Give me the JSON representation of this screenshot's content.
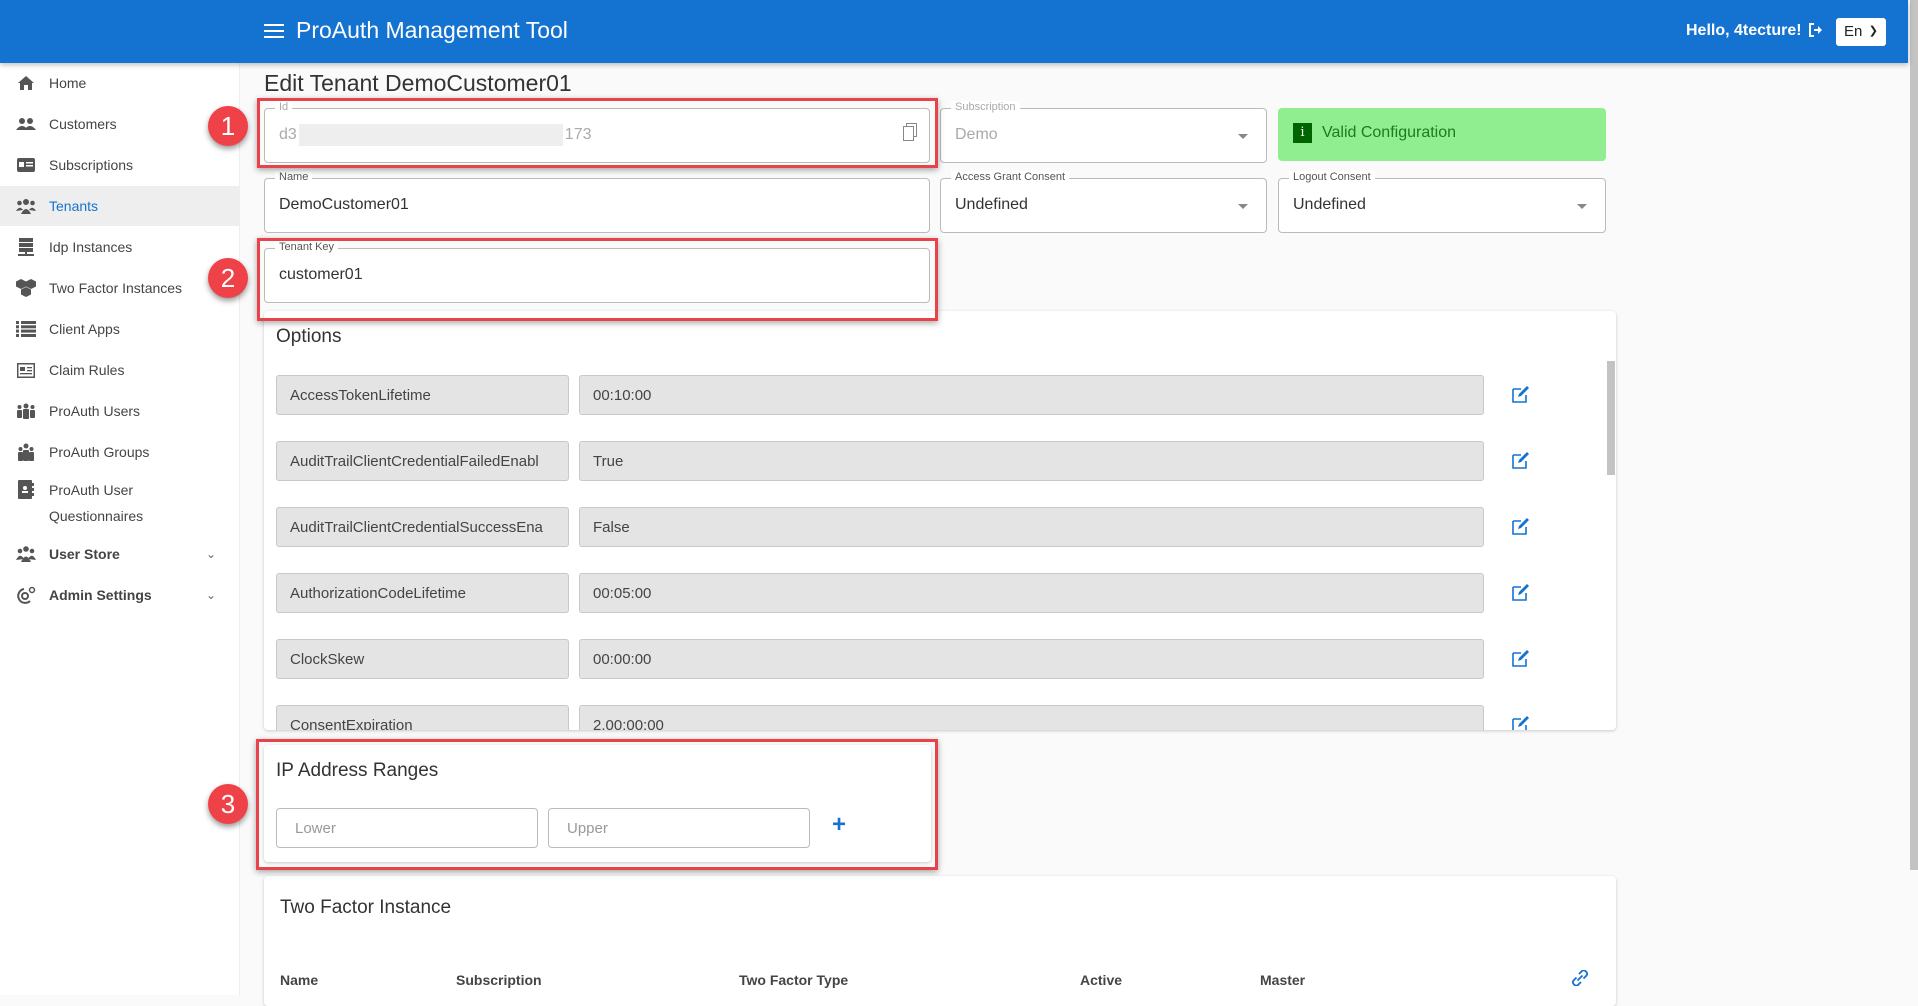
{
  "header": {
    "title": "ProAuth Management Tool",
    "greeting": "Hello, 4tecture!",
    "language": "En"
  },
  "sidebar": {
    "items": [
      {
        "label": "Home",
        "icon": "home-icon"
      },
      {
        "label": "Customers",
        "icon": "customers-icon"
      },
      {
        "label": "Subscriptions",
        "icon": "subscriptions-icon"
      },
      {
        "label": "Tenants",
        "icon": "tenants-icon",
        "active": true
      },
      {
        "label": "Idp Instances",
        "icon": "server-icon"
      },
      {
        "label": "Two Factor Instances",
        "icon": "cubes-icon"
      },
      {
        "label": "Client Apps",
        "icon": "list-icon"
      },
      {
        "label": "Claim Rules",
        "icon": "newspaper-icon"
      },
      {
        "label": "ProAuth Users",
        "icon": "users-icon"
      },
      {
        "label": "ProAuth Groups",
        "icon": "group-icon"
      },
      {
        "label": "ProAuth User Questionnaires",
        "label_line1": "ProAuth User",
        "label_line2": "Questionnaires",
        "icon": "address-book-icon"
      },
      {
        "label": "User Store",
        "icon": "user-store-icon",
        "expandable": true
      },
      {
        "label": "Admin Settings",
        "icon": "admin-settings-icon",
        "expandable": true
      }
    ]
  },
  "page": {
    "title": "Edit Tenant DemoCustomer01"
  },
  "form": {
    "id": {
      "label": "Id",
      "value_prefix": "d3",
      "value_suffix": "173"
    },
    "subscription": {
      "label": "Subscription",
      "value": "Demo"
    },
    "status": {
      "text": "Valid Configuration",
      "icon": "i"
    },
    "name": {
      "label": "Name",
      "value": "DemoCustomer01"
    },
    "access_grant_consent": {
      "label": "Access Grant Consent",
      "value": "Undefined"
    },
    "logout_consent": {
      "label": "Logout Consent",
      "value": "Undefined"
    },
    "tenant_key": {
      "label": "Tenant Key",
      "value": "customer01"
    }
  },
  "options": {
    "title": "Options",
    "rows": [
      {
        "key": "AccessTokenLifetime",
        "value": "00:10:00"
      },
      {
        "key": "AuditTrailClientCredentialFailedEnabl",
        "value": "True"
      },
      {
        "key": "AuditTrailClientCredentialSuccessEna",
        "value": "False"
      },
      {
        "key": "AuthorizationCodeLifetime",
        "value": "00:05:00"
      },
      {
        "key": "ClockSkew",
        "value": "00:00:00"
      },
      {
        "key": "ConsentExpiration",
        "value": "2.00:00:00"
      }
    ]
  },
  "ip_ranges": {
    "title": "IP Address Ranges",
    "lower_placeholder": "Lower",
    "upper_placeholder": "Upper",
    "add_label": "+"
  },
  "two_factor": {
    "title": "Two Factor Instance",
    "columns": [
      "Name",
      "Subscription",
      "Two Factor Type",
      "Active",
      "Master"
    ]
  },
  "annotations": [
    "1",
    "2",
    "3"
  ],
  "colors": {
    "primary": "#1473d0",
    "valid_bg": "#90ee90",
    "valid_text": "#1b7c1b",
    "annotation": "#ef4148"
  }
}
